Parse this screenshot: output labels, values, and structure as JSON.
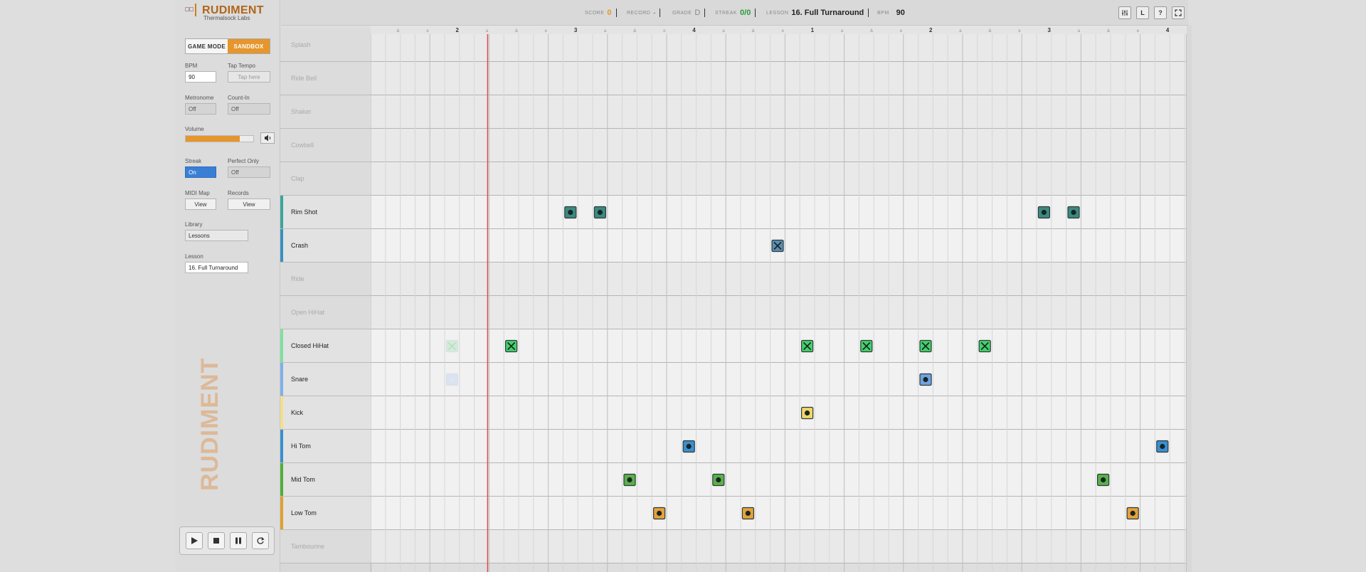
{
  "app": {
    "logo_title": "RUDIMENT",
    "logo_subtitle": "Thermalsock Labs",
    "vertical_brand": "RUDIMENT"
  },
  "mode": {
    "game_label": "GAME MODE",
    "sandbox_label": "SANDBOX",
    "active": "SANDBOX"
  },
  "controls": {
    "bpm_label": "BPM",
    "bpm_value": "90",
    "tap_tempo_label": "Tap Tempo",
    "tap_tempo_placeholder": "Tap here",
    "metronome_label": "Metronome",
    "metronome_value": "Off",
    "count_in_label": "Count-In",
    "count_in_value": "Off",
    "volume_label": "Volume",
    "volume_level": 0.8,
    "streak_label": "Streak",
    "streak_value": "On",
    "perfect_only_label": "Perfect Only",
    "perfect_only_value": "Off",
    "midi_map_label": "MIDI Map",
    "midi_map_button": "View",
    "records_label": "Records",
    "records_button": "View",
    "library_label": "Library",
    "library_value": "Lessons",
    "lesson_label": "Lesson",
    "lesson_value": "16. Full Turnaround"
  },
  "stats": {
    "score_label": "SCORE",
    "score_value": "0",
    "record_label": "RECORD",
    "record_value": "-",
    "grade_label": "GRADE",
    "grade_value": "D",
    "streak_label": "STREAK",
    "streak_value": "0/0",
    "lesson_label": "LESSON",
    "lesson_value": "16. Full Turnaround",
    "bpm_label": "BPM",
    "bpm_value": "90"
  },
  "top_buttons": {
    "mixer_icon": "mixer-icon",
    "l_label": "L",
    "help_label": "?",
    "fullscreen_icon": "fullscreen-icon"
  },
  "transport": {
    "play_icon": "play-icon",
    "stop_icon": "stop-icon",
    "pause_icon": "pause-icon",
    "loop_icon": "loop-icon"
  },
  "beat_labels": [
    "&",
    "e",
    "2",
    "a",
    "&",
    "e",
    "3",
    "a",
    "&",
    "e",
    "4",
    "a",
    "&",
    "e",
    "1",
    "a",
    "&",
    "e",
    "2",
    "a",
    "&",
    "e",
    "3",
    "a",
    "&",
    "e",
    "4"
  ],
  "lanes": [
    {
      "name": "Splash",
      "active": false,
      "color": ""
    },
    {
      "name": "Ride Bell",
      "active": false,
      "color": ""
    },
    {
      "name": "Shaker",
      "active": false,
      "color": ""
    },
    {
      "name": "Cowbell",
      "active": false,
      "color": ""
    },
    {
      "name": "Clap",
      "active": false,
      "color": ""
    },
    {
      "name": "Rim Shot",
      "active": true,
      "color": "#3aa59a"
    },
    {
      "name": "Crash",
      "active": true,
      "color": "#3a8fc0"
    },
    {
      "name": "Ride",
      "active": false,
      "color": ""
    },
    {
      "name": "Open HiHat",
      "active": false,
      "color": ""
    },
    {
      "name": "Closed HiHat",
      "active": true,
      "color": "#7fe0a0"
    },
    {
      "name": "Snare",
      "active": true,
      "color": "#7fb0e8"
    },
    {
      "name": "Kick",
      "active": true,
      "color": "#f2df8a"
    },
    {
      "name": "Hi Tom",
      "active": true,
      "color": "#3a8fd0"
    },
    {
      "name": "Mid Tom",
      "active": true,
      "color": "#4fae3a"
    },
    {
      "name": "Low Tom",
      "active": true,
      "color": "#e0a030"
    },
    {
      "name": "Tambourine",
      "active": false,
      "color": ""
    }
  ],
  "notes": [
    {
      "lane": 5,
      "step": 13.5,
      "kind": "dot",
      "color": "#3a8a80"
    },
    {
      "lane": 5,
      "step": 15.5,
      "kind": "dot",
      "color": "#3a8a80"
    },
    {
      "lane": 5,
      "step": 45.5,
      "kind": "dot",
      "color": "#3a8a80"
    },
    {
      "lane": 5,
      "step": 47.5,
      "kind": "dot",
      "color": "#3a8a80"
    },
    {
      "lane": 6,
      "step": 27.5,
      "kind": "x",
      "color": "#5a8fb5"
    },
    {
      "lane": 9,
      "step": 5.5,
      "kind": "x",
      "color": "#b7e8c4",
      "ghost": true
    },
    {
      "lane": 9,
      "step": 9.5,
      "kind": "x",
      "color": "#43d16a"
    },
    {
      "lane": 9,
      "step": 29.5,
      "kind": "x",
      "color": "#43d16a"
    },
    {
      "lane": 9,
      "step": 33.5,
      "kind": "x",
      "color": "#43d16a"
    },
    {
      "lane": 9,
      "step": 37.5,
      "kind": "x",
      "color": "#43d16a"
    },
    {
      "lane": 9,
      "step": 41.5,
      "kind": "x",
      "color": "#43d16a"
    },
    {
      "lane": 10,
      "step": 5.5,
      "kind": "dot",
      "color": "#c8d8f0",
      "ghost": true
    },
    {
      "lane": 10,
      "step": 37.5,
      "kind": "dot",
      "color": "#6fa3e0"
    },
    {
      "lane": 11,
      "step": 29.5,
      "kind": "dot",
      "color": "#f2d66a"
    },
    {
      "lane": 12,
      "step": 21.5,
      "kind": "dot",
      "color": "#3a8fd0"
    },
    {
      "lane": 12,
      "step": 53.5,
      "kind": "dot",
      "color": "#3a8fd0"
    },
    {
      "lane": 13,
      "step": 17.5,
      "kind": "dot",
      "color": "#5ab04a"
    },
    {
      "lane": 13,
      "step": 23.5,
      "kind": "dot",
      "color": "#5ab04a"
    },
    {
      "lane": 13,
      "step": 49.5,
      "kind": "dot",
      "color": "#5ab04a"
    },
    {
      "lane": 14,
      "step": 19.5,
      "kind": "dot",
      "color": "#e3a23a"
    },
    {
      "lane": 14,
      "step": 25.5,
      "kind": "dot",
      "color": "#e3a23a"
    },
    {
      "lane": 14,
      "step": 51.5,
      "kind": "dot",
      "color": "#e3a23a"
    }
  ],
  "colors": {
    "accent": "#e6962c",
    "playhead": "#e04a4a",
    "streak_on": "#3a7fd5",
    "streak_good": "#2a9a3a"
  }
}
